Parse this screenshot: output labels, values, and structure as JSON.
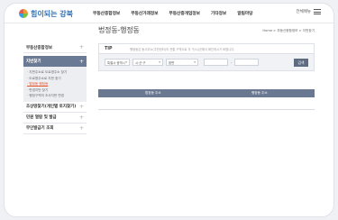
{
  "header": {
    "logo_text": "힘이되는 강북",
    "nav": [
      "부동산종합정보",
      "부동산거래정보",
      "부동산중개업정보",
      "기타정보",
      "알림마당"
    ],
    "all_menu_label": "전체메뉴"
  },
  "sidebar": {
    "items": [
      {
        "label": "부동산종합정보"
      },
      {
        "label": "지번찾기"
      },
      {
        "label": "조상땅찾기(개인별 토지찾기)"
      },
      {
        "label": "민원 열람 및 발급"
      },
      {
        "label": "무인발급기 조회"
      }
    ],
    "subitems": [
      "· 지번주소로 도로명주소 찾기",
      "· 도로명주소로 지번 찾기",
      "· 법정동 행정동",
      "· 변경지번 찾기",
      "· 행정구역의 조사지번 변경"
    ]
  },
  "main": {
    "title": "법정동-행정동",
    "breadcrumb": "Home > 부동산종합정보 > 지번찾기",
    "tip_label": "TIP",
    "tip_text": "· 행정동은 동사무소(주민센터)의 관할 구역으로 각 구/시/군에서 확인하시기 바랍니다.",
    "search": {
      "sido": "특별시·광역시",
      "sigungu": "시·군·구",
      "dong": "읍면",
      "search_button": "검색"
    },
    "table_headers": [
      "법정동 주소",
      "행정동 주소"
    ]
  }
}
